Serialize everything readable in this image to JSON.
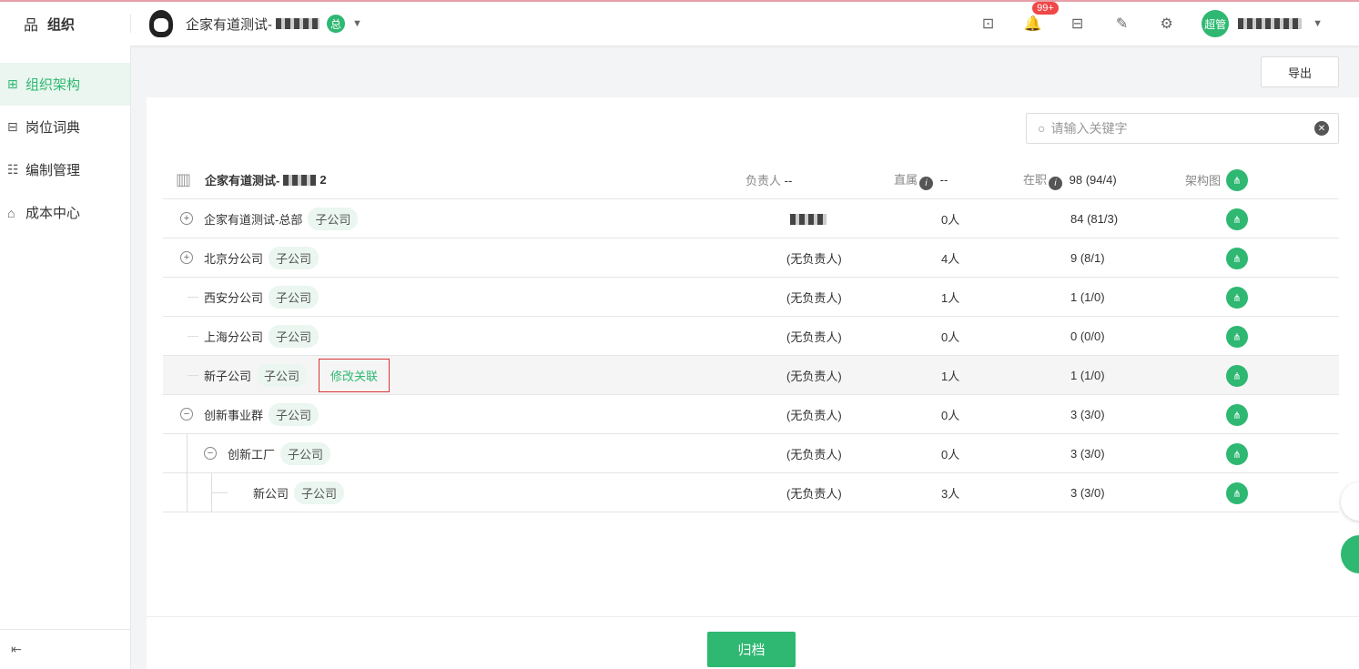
{
  "app": {
    "title": "组织",
    "company": "企家有道测试-",
    "company_badge": "总"
  },
  "topbar": {
    "notif_badge": "99+",
    "user_avatar": "超管"
  },
  "sidebar": {
    "items": [
      {
        "label": "组织架构",
        "icon": "org-tree-icon"
      },
      {
        "label": "岗位词典",
        "icon": "dictionary-icon"
      },
      {
        "label": "编制管理",
        "icon": "list-icon"
      },
      {
        "label": "成本中心",
        "icon": "building-icon"
      }
    ]
  },
  "actions": {
    "export_label": "导出",
    "archive_label": "归档"
  },
  "search": {
    "placeholder": "请输入关键字",
    "value": ""
  },
  "header": {
    "name": "企家有道测试-",
    "name_suffix": "2",
    "owner_label": "负责人",
    "owner_value": "--",
    "direct_label": "直属",
    "direct_value": "--",
    "staff_label": "在职",
    "staff_value": "98 (94/4)",
    "chart_label": "架构图"
  },
  "rows": [
    {
      "name": "企家有道测试-总部",
      "tag": "子公司",
      "owner": "",
      "direct": "0人",
      "staff": "84 (81/3)"
    },
    {
      "name": "北京分公司",
      "tag": "子公司",
      "owner": "(无负责人)",
      "direct": "4人",
      "staff": "9 (8/1)"
    },
    {
      "name": "西安分公司",
      "tag": "子公司",
      "owner": "(无负责人)",
      "direct": "1人",
      "staff": "1 (1/0)"
    },
    {
      "name": "上海分公司",
      "tag": "子公司",
      "owner": "(无负责人)",
      "direct": "0人",
      "staff": "0 (0/0)"
    },
    {
      "name": "新子公司",
      "tag": "子公司",
      "edit": "修改关联",
      "owner": "(无负责人)",
      "direct": "1人",
      "staff": "1 (1/0)"
    },
    {
      "name": "创新事业群",
      "tag": "子公司",
      "owner": "(无负责人)",
      "direct": "0人",
      "staff": "3 (3/0)"
    },
    {
      "name": "创新工厂",
      "tag": "子公司",
      "owner": "(无负责人)",
      "direct": "0人",
      "staff": "3 (3/0)"
    },
    {
      "name": "新公司",
      "tag": "子公司",
      "owner": "(无负责人)",
      "direct": "3人",
      "staff": "3 (3/0)"
    }
  ]
}
